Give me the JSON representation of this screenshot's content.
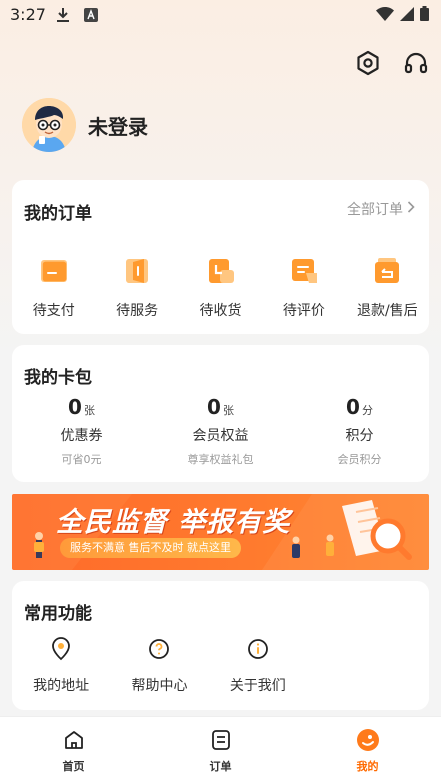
{
  "status_bar": {
    "time": "3:27"
  },
  "profile": {
    "name": "未登录"
  },
  "orders": {
    "title": "我的订单",
    "all_label": "全部订单",
    "items": [
      {
        "label": "待支付",
        "icon": "wallet-icon"
      },
      {
        "label": "待服务",
        "icon": "service-icon"
      },
      {
        "label": "待收货",
        "icon": "receipt-icon"
      },
      {
        "label": "待评价",
        "icon": "review-icon"
      },
      {
        "label": "退款/售后",
        "icon": "refund-icon"
      }
    ]
  },
  "wallet": {
    "title": "我的卡包",
    "items": [
      {
        "value": "0",
        "unit": "张",
        "name": "优惠券",
        "sub": "可省0元"
      },
      {
        "value": "0",
        "unit": "张",
        "name": "会员权益",
        "sub": "尊享权益礼包"
      },
      {
        "value": "0",
        "unit": "分",
        "name": "积分",
        "sub": "会员积分"
      }
    ]
  },
  "banner": {
    "title": "全民监督 举报有奖",
    "pill": "服务不满意 售后不及时 就点这里"
  },
  "common": {
    "title": "常用功能",
    "items": [
      {
        "label": "我的地址",
        "icon": "location-icon"
      },
      {
        "label": "帮助中心",
        "icon": "help-icon"
      },
      {
        "label": "关于我们",
        "icon": "info-icon"
      }
    ]
  },
  "tabbar": {
    "items": [
      {
        "label": "首页",
        "icon": "home-icon"
      },
      {
        "label": "订单",
        "icon": "order-icon"
      },
      {
        "label": "我的",
        "icon": "profile-icon"
      }
    ]
  },
  "colors": {
    "accent": "#ff6a00",
    "icon_orange": "#ff9a2e",
    "banner": "#ff6a2a"
  }
}
